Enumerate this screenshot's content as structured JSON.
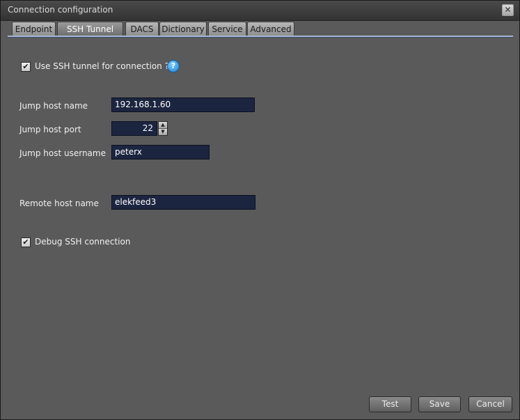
{
  "window": {
    "title": "Connection configuration",
    "close_glyph": "✕"
  },
  "tabs": [
    {
      "label": "Endpoint",
      "active": false
    },
    {
      "label": "SSH Tunnel",
      "active": true
    },
    {
      "label": "DACS",
      "active": false
    },
    {
      "label": "Dictionary",
      "active": false
    },
    {
      "label": "Service",
      "active": false
    },
    {
      "label": "Advanced",
      "active": false
    }
  ],
  "ssh": {
    "use_tunnel_label": "Use SSH tunnel for connection ?",
    "use_tunnel_checked": true,
    "help_glyph": "?",
    "jump_host_name_label": "Jump host name",
    "jump_host_name_value": "192.168.1.60",
    "jump_host_port_label": "Jump host port",
    "jump_host_port_value": "22",
    "jump_host_username_label": "Jump host username",
    "jump_host_username_value": "peterx",
    "remote_host_name_label": "Remote host name",
    "remote_host_name_value": "elekfeed3",
    "debug_label": "Debug SSH connection",
    "debug_checked": true,
    "check_glyph": "✔"
  },
  "buttons": {
    "test": "Test",
    "save": "Save",
    "cancel": "Cancel"
  },
  "colors": {
    "panel_bg": "#5a5a5a",
    "field_bg": "#1c2540",
    "help_icon": "#1f7fd0"
  }
}
